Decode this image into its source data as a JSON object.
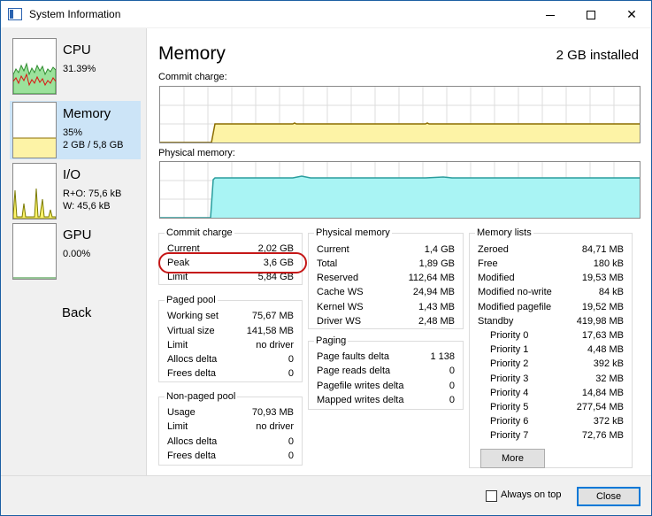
{
  "window": {
    "title": "System Information",
    "icon": "app-window-icon"
  },
  "titlebar_buttons": [
    "minimize-icon",
    "maximize-icon",
    "close-icon"
  ],
  "sidebar": {
    "items": [
      {
        "label": "CPU",
        "lines": [
          "31.39%"
        ],
        "usage_level": 0.31
      },
      {
        "label": "Memory",
        "lines": [
          "35%",
          "2 GB / 5,8 GB"
        ],
        "usage_level": 0.35
      },
      {
        "label": "I/O",
        "lines": [
          "R+O: 75,6 kB",
          "W: 45,6 kB"
        ]
      },
      {
        "label": "GPU",
        "lines": [
          "0.00%"
        ]
      }
    ],
    "back_label": "Back"
  },
  "main": {
    "title": "Memory",
    "installed": "2 GB installed",
    "commit_chart_label": "Commit charge:",
    "physical_chart_label": "Physical memory:",
    "colors": {
      "commit_fill": "#fdf3a6",
      "commit_line": "#8b6d00",
      "physical_fill": "#a9f4f4",
      "physical_line": "#2a9d9d",
      "highlight_ring": "#c51717"
    }
  },
  "commit_charge": {
    "title": "Commit charge",
    "rows": [
      {
        "k": "Current",
        "v": "2,02 GB"
      },
      {
        "k": "Peak",
        "v": "3,6 GB",
        "highlighted": true
      },
      {
        "k": "Limit",
        "v": "5,84 GB"
      }
    ]
  },
  "paged_pool": {
    "title": "Paged pool",
    "rows": [
      {
        "k": "Working set",
        "v": "75,67 MB"
      },
      {
        "k": "Virtual size",
        "v": "141,58 MB"
      },
      {
        "k": "Limit",
        "v": "no driver"
      },
      {
        "k": "Allocs delta",
        "v": "0"
      },
      {
        "k": "Frees delta",
        "v": "0"
      }
    ]
  },
  "nonpaged_pool": {
    "title": "Non-paged pool",
    "rows": [
      {
        "k": "Usage",
        "v": "70,93 MB"
      },
      {
        "k": "Limit",
        "v": "no driver"
      },
      {
        "k": "Allocs delta",
        "v": "0"
      },
      {
        "k": "Frees delta",
        "v": "0"
      }
    ]
  },
  "physical_memory": {
    "title": "Physical memory",
    "rows": [
      {
        "k": "Current",
        "v": "1,4 GB"
      },
      {
        "k": "Total",
        "v": "1,89 GB"
      },
      {
        "k": "Reserved",
        "v": "112,64 MB"
      },
      {
        "k": "Cache WS",
        "v": "24,94 MB"
      },
      {
        "k": "Kernel WS",
        "v": "1,43 MB"
      },
      {
        "k": "Driver WS",
        "v": "2,48 MB"
      }
    ]
  },
  "paging": {
    "title": "Paging",
    "rows": [
      {
        "k": "Page faults delta",
        "v": "1 138"
      },
      {
        "k": "Page reads delta",
        "v": "0"
      },
      {
        "k": "Pagefile writes delta",
        "v": "0"
      },
      {
        "k": "Mapped writes delta",
        "v": "0"
      }
    ]
  },
  "memory_lists": {
    "title": "Memory lists",
    "rows": [
      {
        "k": "Zeroed",
        "v": "84,71 MB"
      },
      {
        "k": "Free",
        "v": "180 kB"
      },
      {
        "k": "Modified",
        "v": "19,53 MB"
      },
      {
        "k": "Modified no-write",
        "v": "84 kB"
      },
      {
        "k": "Modified pagefile",
        "v": "19,52 MB"
      },
      {
        "k": "Standby",
        "v": "419,98 MB"
      },
      {
        "k": "Priority 0",
        "v": "17,63 MB",
        "indent": true
      },
      {
        "k": "Priority 1",
        "v": "4,48 MB",
        "indent": true
      },
      {
        "k": "Priority 2",
        "v": "392 kB",
        "indent": true
      },
      {
        "k": "Priority 3",
        "v": "32 MB",
        "indent": true
      },
      {
        "k": "Priority 4",
        "v": "14,84 MB",
        "indent": true
      },
      {
        "k": "Priority 5",
        "v": "277,54 MB",
        "indent": true
      },
      {
        "k": "Priority 6",
        "v": "372 kB",
        "indent": true
      },
      {
        "k": "Priority 7",
        "v": "72,76 MB",
        "indent": true
      }
    ],
    "more_label": "More"
  },
  "footer": {
    "always_on_top_label": "Always on top",
    "always_on_top_checked": false,
    "close_label": "Close"
  }
}
